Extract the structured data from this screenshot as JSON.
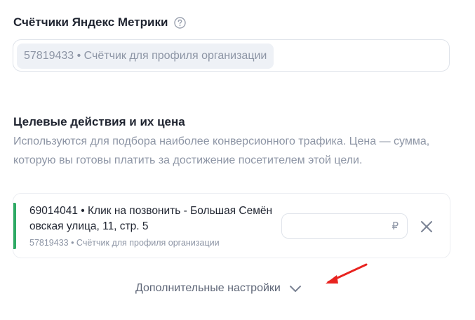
{
  "counters_section": {
    "title": "Счётчики Яндекс Метрики",
    "help_icon": "question-circle-icon",
    "selected_counter": "57819433 • Счётчик для профиля организации"
  },
  "goals_section": {
    "title": "Целевые действия и их цена",
    "description": "Используются для подбора наиболее конверсионного трафика. Цена — сумма, которую вы готовы платить за достижение посетителем этой цели.",
    "goals": [
      {
        "name_line1": "69014041 • Клик на позвонить - Большая Семён",
        "name_line2": "овская улица, 11, стр. 5",
        "counter": "57819433 • Счётчик для профиля организации",
        "price_value": "",
        "currency": "₽",
        "remove_icon": "close-icon"
      }
    ]
  },
  "more_settings": {
    "label": "Дополнительные настройки",
    "icon": "chevron-down-icon"
  },
  "colors": {
    "accent_green": "#2eaa64",
    "annotation_red": "#e8231f",
    "muted_text": "#8d95a5"
  }
}
